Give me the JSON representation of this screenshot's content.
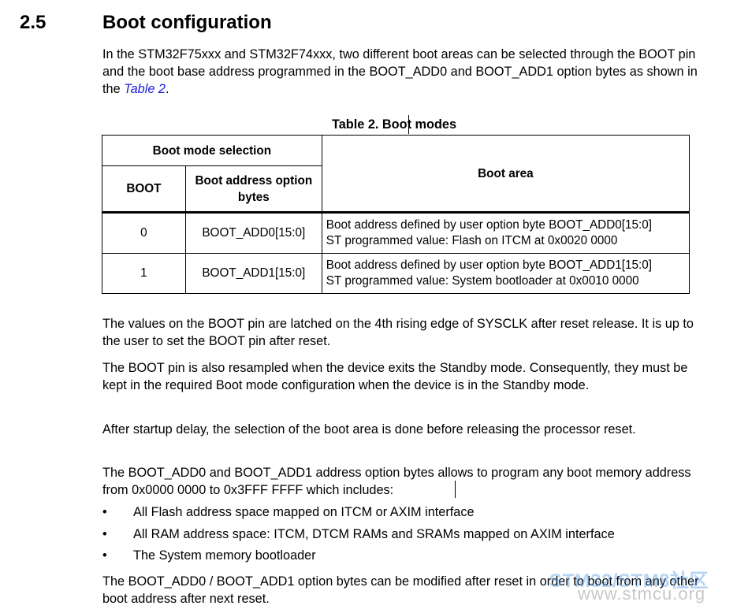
{
  "section": {
    "number": "2.5",
    "title": "Boot configuration"
  },
  "intro": {
    "text_before_link": "In the STM32F75xxx and STM32F74xxx, two different boot areas can be selected through the BOOT pin and the boot base address programmed in the BOOT_ADD0 and BOOT_ADD1 option bytes as shown in the ",
    "link": "Table 2",
    "text_after_link": "."
  },
  "table": {
    "caption": "Table 2. Boot modes",
    "header_group": "Boot mode selection",
    "col_boot": "BOOT",
    "col_address": "Boot address option bytes",
    "col_area": "Boot area",
    "rows": [
      {
        "boot": "0",
        "address": "BOOT_ADD0[15:0]",
        "area_line1": "Boot address defined by user option byte BOOT_ADD0[15:0]",
        "area_line2": "ST programmed value: Flash on ITCM at 0x0020 0000"
      },
      {
        "boot": "1",
        "address": "BOOT_ADD1[15:0]",
        "area_line1": "Boot address defined by user option byte BOOT_ADD1[15:0]",
        "area_line2": "ST programmed value: System bootloader at 0x0010 0000"
      }
    ]
  },
  "paragraphs": [
    "The values on the BOOT pin are latched on the 4th rising edge of SYSCLK after reset release. It is up to the user to set the BOOT pin after reset.",
    "The BOOT pin is also resampled when the device exits the Standby mode. Consequently, they must be kept in the required Boot mode configuration when the device is in the Standby mode.",
    "After startup delay, the selection of the boot area is done before releasing the processor reset.",
    "The BOOT_ADD0 and BOOT_ADD1 address option bytes allows to program any boot memory address from 0x0000 0000 to 0x3FFF FFFF which includes:"
  ],
  "bullets": [
    "All Flash address space mapped on ITCM or AXIM interface",
    "All RAM address space: ITCM, DTCM RAMs and SRAMs mapped on AXIM interface",
    "The System memory bootloader"
  ],
  "closing": "The BOOT_ADD0 / BOOT_ADD1 option bytes can be modified after reset in order to boot from any other boot address after next reset.",
  "watermark": {
    "line1": "STM32/STM8社区",
    "line2": "www.stmcu.org"
  },
  "colors": {
    "link": "#1a1adc",
    "watermark_blue": "#5aa0e6",
    "watermark_gray": "#828282"
  }
}
